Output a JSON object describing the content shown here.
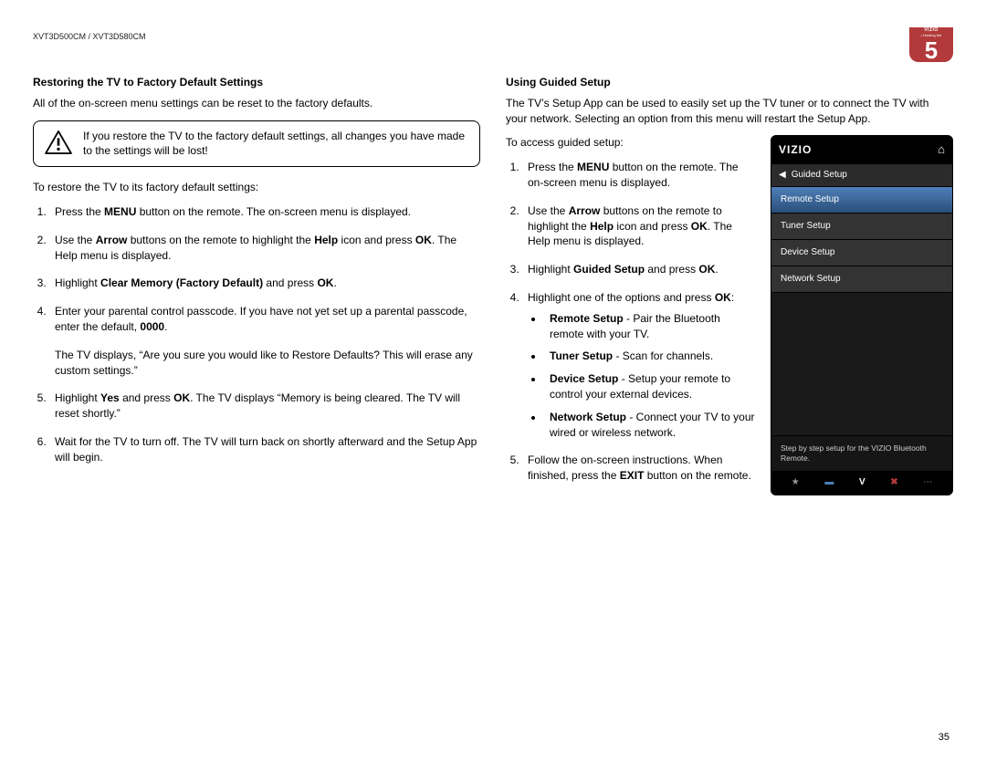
{
  "header": {
    "model": "XVT3D500CM / XVT3D580CM",
    "badge_brand": "VIZIO",
    "badge_sub": "• Holding the",
    "chapter_number": "5"
  },
  "left": {
    "title": "Restoring the TV to Factory Default Settings",
    "intro": "All of the on-screen menu settings can be reset to the factory defaults.",
    "warning": "If you restore the TV to the factory default settings, all changes you have made to the settings will be lost!",
    "lead": "To restore the TV to its factory default settings:",
    "step1_a": "Press the ",
    "step1_b": "MENU",
    "step1_c": " button on the remote. The on-screen menu is displayed.",
    "step2_a": "Use the ",
    "step2_b": "Arrow",
    "step2_c": " buttons on the remote to highlight the ",
    "step2_d": "Help",
    "step2_e": " icon and press ",
    "step2_f": "OK",
    "step2_g": ". The Help menu is displayed.",
    "step3_a": "Highlight ",
    "step3_b": "Clear Memory (Factory Default)",
    "step3_c": " and press ",
    "step3_d": "OK",
    "step3_e": ".",
    "step4_a": "Enter your parental control passcode. If you have not yet set up a parental passcode, enter the default, ",
    "step4_b": "0000",
    "step4_c": ".",
    "step4_sub": "The TV displays, “Are you sure you would like to Restore Defaults? This will erase any custom settings.”",
    "step5_a": "Highlight ",
    "step5_b": "Yes",
    "step5_c": " and press ",
    "step5_d": "OK",
    "step5_e": ". The TV displays “Memory is being cleared. The TV will reset shortly.”",
    "step6": "Wait for the TV to turn off. The TV will turn back on shortly afterward and the Setup App will begin."
  },
  "right": {
    "title": "Using Guided Setup",
    "intro": "The TV’s Setup App can be used to easily set up the TV tuner or to connect the TV with your network. Selecting an option from this menu will restart the Setup App.",
    "lead": "To access guided setup:",
    "step1_a": "Press the ",
    "step1_b": "MENU",
    "step1_c": " button on the remote. The on-screen menu is displayed.",
    "step2_a": "Use the ",
    "step2_b": "Arrow",
    "step2_c": " buttons on the remote to highlight the ",
    "step2_d": "Help",
    "step2_e": " icon and press ",
    "step2_f": "OK",
    "step2_g": ". The Help menu is displayed.",
    "step3_a": "Highlight ",
    "step3_b": "Guided Setup",
    "step3_c": " and press ",
    "step3_d": "OK",
    "step3_e": ".",
    "step4_a": "Highlight one of the options and press ",
    "step4_b": "OK",
    "step4_c": ":",
    "opt1_a": "Remote Setup",
    "opt1_b": " - Pair the Bluetooth remote with your TV.",
    "opt2_a": "Tuner Setup",
    "opt2_b": " - Scan for channels.",
    "opt3_a": "Device Setup",
    "opt3_b": " - Setup your remote to control your external devices.",
    "opt4_a": "Network Setup",
    "opt4_b": " - Connect your TV to your wired or wireless network.",
    "step5_a": "Follow the on-screen instructions. When finished, press the ",
    "step5_b": "EXIT",
    "step5_c": " button on the remote."
  },
  "tv_menu": {
    "brand": "VIZIO",
    "crumb": "Guided Setup",
    "items": [
      "Remote Setup",
      "Tuner Setup",
      "Device Setup",
      "Network Setup"
    ],
    "desc": "Step by step setup for the VIZIO Bluetooth Remote.",
    "b_star": "★",
    "b_back": "▬",
    "b_v": "V",
    "b_x": "✖",
    "b_more": "⋯"
  },
  "page_number": "35"
}
